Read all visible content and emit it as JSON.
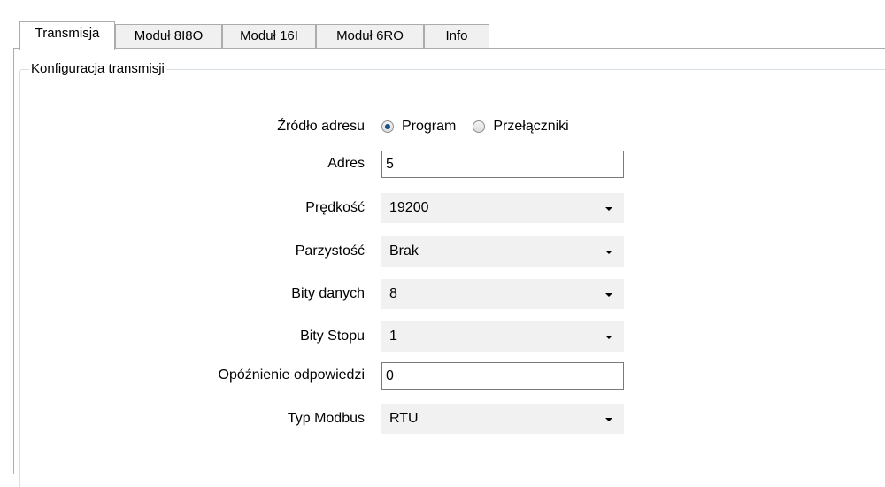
{
  "tabs": [
    "Transmisja",
    "Moduł 8I8O",
    "Moduł 16I",
    "Moduł 6RO",
    "Info"
  ],
  "active_tab": "Transmisja",
  "group_title": "Konfiguracja transmisji",
  "form": {
    "address_source": {
      "label": "Źródło adresu",
      "options": [
        "Program",
        "Przełączniki"
      ],
      "selected": "Program"
    },
    "address": {
      "label": "Adres",
      "value": "5"
    },
    "speed": {
      "label": "Prędkość",
      "value": "19200"
    },
    "parity": {
      "label": "Parzystość",
      "value": "Brak"
    },
    "data_bits": {
      "label": "Bity danych",
      "value": "8"
    },
    "stop_bits": {
      "label": "Bity Stopu",
      "value": "1"
    },
    "response_delay": {
      "label": "Opóźnienie odpowiedzi",
      "value": "0"
    },
    "modbus_type": {
      "label": "Typ Modbus",
      "value": "RTU"
    }
  },
  "colors": {
    "tab_active_bg": "#ffffff",
    "tab_bg": "#f0f0f0",
    "combo_bg": "#f1f1f1",
    "radio_dot": "#1c4f86"
  }
}
